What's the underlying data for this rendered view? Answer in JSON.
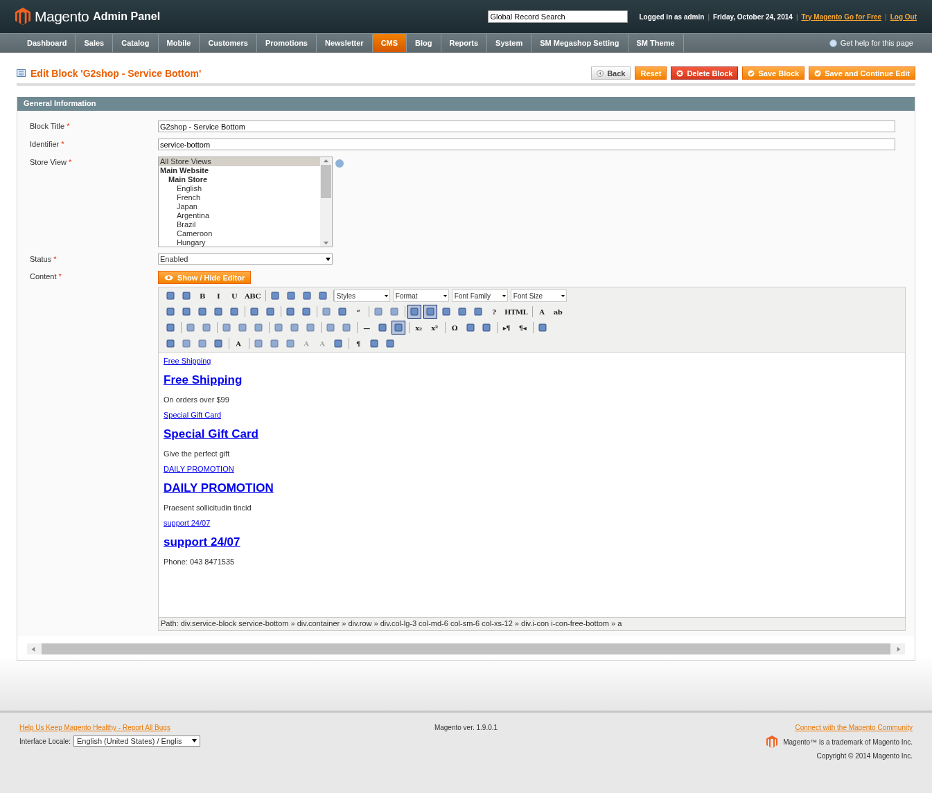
{
  "header": {
    "logo": "Magento",
    "logo_suffix": "Admin Panel",
    "search": {
      "value": "Global Record Search"
    },
    "logged_in": "Logged in as admin",
    "separator": "|",
    "date": "Friday, October 24, 2014",
    "links": [
      "Try Magento Go for Free",
      "Log Out"
    ]
  },
  "nav": {
    "items": [
      {
        "label": "Dashboard",
        "selected": false
      },
      {
        "label": "Sales",
        "selected": false
      },
      {
        "label": "Catalog",
        "selected": false
      },
      {
        "label": "Mobile",
        "selected": false
      },
      {
        "label": "Customers",
        "selected": false
      },
      {
        "label": "Promotions",
        "selected": false
      },
      {
        "label": "Newsletter",
        "selected": false
      },
      {
        "label": "CMS",
        "selected": true
      },
      {
        "label": "Blog",
        "selected": false
      },
      {
        "label": "Reports",
        "selected": false
      },
      {
        "label": "System",
        "selected": false
      },
      {
        "label": "SM Megashop Setting",
        "selected": false
      },
      {
        "label": "SM Theme",
        "selected": false
      }
    ],
    "help": "Get help for this page"
  },
  "page": {
    "title": "Edit Block 'G2shop - Service Bottom'",
    "buttons": [
      {
        "label": "Back",
        "kind": "back"
      },
      {
        "label": "Reset",
        "kind": "plain"
      },
      {
        "label": "Delete Block",
        "kind": "delete"
      },
      {
        "label": "Save Block",
        "kind": "save"
      },
      {
        "label": "Save and Continue Edit",
        "kind": "save"
      }
    ]
  },
  "section": {
    "title": "General Information"
  },
  "form": {
    "required_mark": "*",
    "block_title": {
      "label": "Block Title",
      "value": "G2shop - Service Bottom"
    },
    "identifier": {
      "label": "Identifier",
      "value": "service-bottom"
    },
    "store_view": {
      "label": "Store View",
      "options": [
        {
          "label": "All Store Views",
          "selected": true
        },
        {
          "label": "Main Website",
          "selected": false,
          "children": [
            {
              "label": "Main Store",
              "selected": false,
              "children": [
                {
                  "label": "English",
                  "selected": false
                },
                {
                  "label": "French",
                  "selected": false
                },
                {
                  "label": "Japan",
                  "selected": false
                },
                {
                  "label": "Argentina",
                  "selected": false
                },
                {
                  "label": "Brazil",
                  "selected": false
                },
                {
                  "label": "Cameroon",
                  "selected": false
                },
                {
                  "label": "Hungary",
                  "selected": false
                }
              ]
            }
          ]
        }
      ]
    },
    "status": {
      "label": "Status",
      "value": "Enabled"
    },
    "content": {
      "label": "Content",
      "toggle": "Show / Hide Editor"
    }
  },
  "editor": {
    "toolbar_rows": [
      [
        [
          {
            "selected": false,
            "disabled": false
          },
          {
            "selected": false,
            "disabled": false
          },
          {
            "label": "B",
            "selected": false,
            "disabled": false
          },
          {
            "label": "I",
            "selected": false,
            "disabled": false
          },
          {
            "label": "U",
            "selected": false,
            "disabled": false
          },
          {
            "label": "ABC",
            "selected": false,
            "disabled": false
          }
        ],
        [
          {
            "selected": false,
            "disabled": false
          },
          {
            "selected": false,
            "disabled": false
          },
          {
            "selected": false,
            "disabled": false
          },
          {
            "selected": false,
            "disabled": false
          }
        ]
      ],
      [
        [
          {
            "selected": false,
            "disabled": false
          },
          {
            "selected": false,
            "disabled": false
          },
          {
            "selected": false,
            "disabled": false
          },
          {
            "selected": false,
            "disabled": false
          },
          {
            "selected": false,
            "disabled": false
          }
        ],
        [
          {
            "selected": false,
            "disabled": false
          },
          {
            "selected": false,
            "disabled": false
          }
        ],
        [
          {
            "selected": false,
            "disabled": false
          },
          {
            "selected": false,
            "disabled": false
          }
        ],
        [
          {
            "selected": false,
            "disabled": true
          },
          {
            "selected": false,
            "disabled": false
          },
          {
            "label": "“",
            "selected": false,
            "disabled": false
          }
        ],
        [
          {
            "selected": false,
            "disabled": true
          },
          {
            "selected": false,
            "disabled": true
          }
        ],
        [
          {
            "selected": true,
            "disabled": false
          },
          {
            "selected": true,
            "disabled": false
          },
          {
            "selected": false,
            "disabled": false
          },
          {
            "selected": false,
            "disabled": false
          },
          {
            "selected": false,
            "disabled": false
          },
          {
            "label": "?",
            "selected": false,
            "disabled": false
          },
          {
            "label": "HTML",
            "selected": false,
            "disabled": false
          }
        ],
        [
          {
            "label": "A",
            "selected": false,
            "disabled": false
          },
          {
            "label": "ab",
            "selected": false,
            "disabled": false
          }
        ]
      ],
      [
        [
          {
            "selected": false,
            "disabled": false
          }
        ],
        [
          {
            "selected": false,
            "disabled": true
          },
          {
            "selected": false,
            "disabled": true
          }
        ],
        [
          {
            "selected": false,
            "disabled": true
          },
          {
            "selected": false,
            "disabled": true
          },
          {
            "selected": false,
            "disabled": true
          }
        ],
        [
          {
            "selected": false,
            "disabled": true
          },
          {
            "selected": false,
            "disabled": true
          },
          {
            "selected": false,
            "disabled": true
          }
        ],
        [
          {
            "selected": false,
            "disabled": true
          },
          {
            "selected": false,
            "disabled": true
          }
        ],
        [
          {
            "label": "—",
            "selected": false,
            "disabled": false
          },
          {
            "selected": false,
            "disabled": false
          },
          {
            "selected": true,
            "disabled": false
          }
        ],
        [
          {
            "label": "x₂",
            "selected": false,
            "disabled": false
          },
          {
            "label": "x²",
            "selected": false,
            "disabled": false
          }
        ],
        [
          {
            "label": "Ω",
            "selected": false,
            "disabled": false
          },
          {
            "selected": false,
            "disabled": false
          },
          {
            "selected": false,
            "disabled": false
          }
        ],
        [
          {
            "label": "▸¶",
            "selected": false,
            "disabled": false
          },
          {
            "label": "¶◂",
            "selected": false,
            "disabled": false
          }
        ],
        [
          {
            "selected": false,
            "disabled": false
          }
        ]
      ],
      [
        [
          {
            "selected": false,
            "disabled": false
          },
          {
            "selected": false,
            "disabled": true
          },
          {
            "selected": false,
            "disabled": true
          },
          {
            "selected": false,
            "disabled": false
          }
        ],
        [
          {
            "label": "A",
            "selected": false,
            "disabled": false
          }
        ],
        [
          {
            "selected": false,
            "disabled": true
          },
          {
            "selected": false,
            "disabled": true
          },
          {
            "selected": false,
            "disabled": true
          },
          {
            "label": "A",
            "selected": false,
            "disabled": true
          },
          {
            "label": "A",
            "selected": false,
            "disabled": true
          },
          {
            "selected": false,
            "disabled": false
          }
        ],
        [
          {
            "label": "¶",
            "selected": false,
            "disabled": false
          },
          {
            "selected": false,
            "disabled": false
          },
          {
            "selected": false,
            "disabled": false
          }
        ]
      ]
    ],
    "selects": [
      "Styles",
      "Format",
      "Font Family",
      "Font Size"
    ],
    "content": [
      {
        "kind": "link",
        "text": "Free Shipping"
      },
      {
        "kind": "heading",
        "text": "Free Shipping"
      },
      {
        "kind": "text",
        "text": "On orders over $99"
      },
      {
        "kind": "link",
        "text": "Special Gift Card"
      },
      {
        "kind": "heading",
        "text": "Special Gift Card"
      },
      {
        "kind": "text",
        "text": "Give the perfect gift"
      },
      {
        "kind": "link",
        "text": "DAILY PROMOTION"
      },
      {
        "kind": "heading",
        "text": "DAILY PROMOTION"
      },
      {
        "kind": "text",
        "text": "Praesent sollicitudin tincid"
      },
      {
        "kind": "link",
        "text": "support 24/07"
      },
      {
        "kind": "heading",
        "text": "support 24/07"
      },
      {
        "kind": "text",
        "text": "Phone: 043 8471535"
      }
    ],
    "path": "Path: div.service-block service-bottom » div.container » div.row » div.col-lg-3 col-md-6 col-sm-6 col-xs-12 » div.i-con i-con-free-bottom » a"
  },
  "footer": {
    "report_link": "Help Us Keep Magento Healthy - Report All Bugs",
    "locale_label": "Interface Locale:",
    "locale_value": "English (United States) / Englis",
    "version": "Magento ver. 1.9.0.1",
    "community_link": "Connect with the Magento Community",
    "trademark": "Magento™ is a trademark of Magento Inc.",
    "copyright": "Copyright © 2014 Magento Inc."
  }
}
